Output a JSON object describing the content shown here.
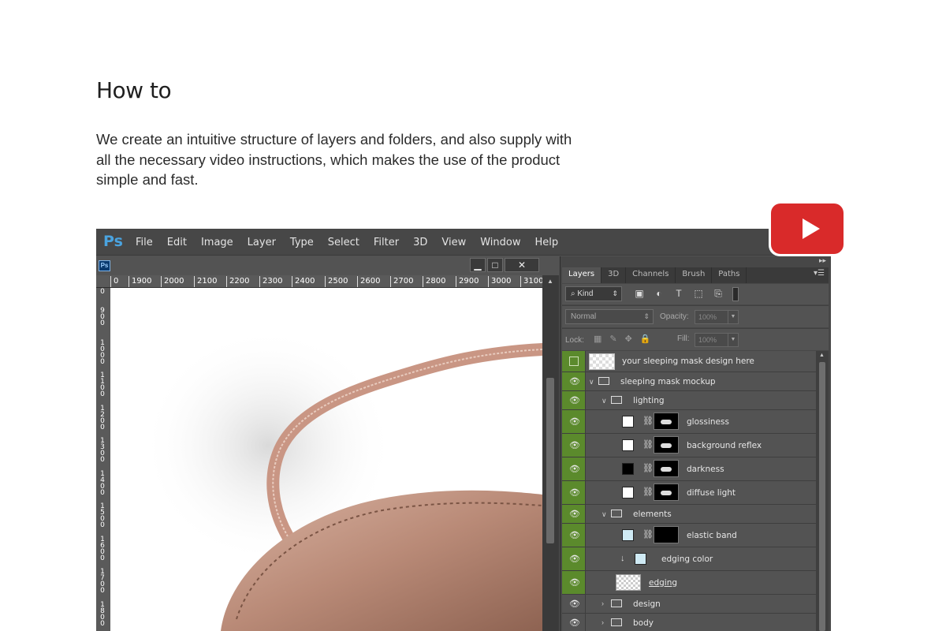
{
  "heading": "How to",
  "description": "We create an intuitive structure of layers and folders, and also supply with all the necessary video instructions, which makes the use of the product simple and fast.",
  "ps": {
    "logo": "Ps",
    "menu": [
      "File",
      "Edit",
      "Image",
      "Layer",
      "Type",
      "Select",
      "Filter",
      "3D",
      "View",
      "Window",
      "Help"
    ],
    "doc_icon": "Ps",
    "ruler_h": [
      "0",
      "1900",
      "2000",
      "2100",
      "2200",
      "2300",
      "2400",
      "2500",
      "2600",
      "2700",
      "2800",
      "2900",
      "3000",
      "3100"
    ],
    "ruler_v": [
      "0",
      "900",
      "1000",
      "1100",
      "1200",
      "1300",
      "1400",
      "1500",
      "1600",
      "1700",
      "1800"
    ],
    "window_buttons": [
      "minimize-icon",
      "maximize-icon",
      "close-icon"
    ]
  },
  "layers_panel": {
    "tabs": [
      "Layers",
      "3D",
      "Channels",
      "Brush",
      "Paths"
    ],
    "active_tab": "Layers",
    "filter_kind": "Kind",
    "blend_mode": "Normal",
    "opacity_label": "Opacity:",
    "opacity_value": "100%",
    "lock_label": "Lock:",
    "fill_label": "Fill:",
    "fill_value": "100%",
    "layers": [
      {
        "name": "your sleeping mask design here"
      },
      {
        "name": "sleeping mask mockup"
      },
      {
        "name": "lighting"
      },
      {
        "name": "glossiness"
      },
      {
        "name": "background reflex"
      },
      {
        "name": "darkness"
      },
      {
        "name": "diffuse light"
      },
      {
        "name": "elements"
      },
      {
        "name": "elastic band"
      },
      {
        "name": "edging color"
      },
      {
        "name": "edging"
      },
      {
        "name": "design"
      },
      {
        "name": "body"
      }
    ]
  },
  "colors": {
    "ps_bg": "#535353",
    "eye_green": "#5b8a2c",
    "youtube_red": "#d92a2a"
  },
  "video_button_icon": "youtube-play-icon"
}
